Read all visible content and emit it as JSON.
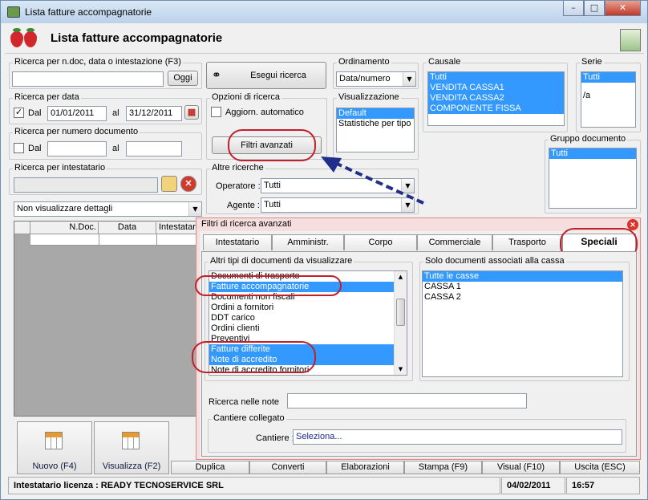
{
  "window": {
    "title": "Lista fatture accompagnatorie",
    "minimize": "–",
    "maximize": "□",
    "close": "✕"
  },
  "header": {
    "title": "Lista fatture accompagnatorie"
  },
  "search_ndoc": {
    "legend": "Ricerca per n.doc, data o intestazione (F3)",
    "value": "",
    "today_button": "Oggi"
  },
  "search_button": "Esegui ricerca",
  "ordering": {
    "legend": "Ordinamento",
    "value": "Data/numero"
  },
  "causale": {
    "legend": "Causale",
    "items": [
      "Tutti",
      "VENDITA CASSA1",
      "VENDITA CASSA2",
      "COMPONENTE FISSA"
    ]
  },
  "serie": {
    "legend": "Serie",
    "items": [
      "Tutti",
      "",
      "/a"
    ]
  },
  "search_date": {
    "legend": "Ricerca per data",
    "dal_label": "Dal",
    "dal_checked": "✓",
    "dal_value": "01/01/2011",
    "al_label": "al",
    "al_value": "31/12/2011"
  },
  "options": {
    "legend": "Opzioni di ricerca",
    "auto_update": "Aggiorn. automatico",
    "advanced_button": "Filtri avanzati"
  },
  "visualization": {
    "legend": "Visualizzazione",
    "items": [
      "Default",
      "Statistiche per tipo a"
    ]
  },
  "search_number": {
    "legend": "Ricerca per numero documento",
    "dal_label": "Dal",
    "al_label": "al"
  },
  "group_doc": {
    "legend": "Gruppo documento",
    "items": [
      "Tutti"
    ]
  },
  "search_holder": {
    "legend": "Ricerca per intestatario"
  },
  "other_search": {
    "legend": "Altre ricerche",
    "operator_label": "Operatore :",
    "operator_value": "Tutti",
    "agent_label": "Agente :",
    "agent_value": "Tutti"
  },
  "details_combo": "Non visualizzare dettagli",
  "grid": {
    "columns": [
      "N.Doc.",
      "Data",
      "Intestatario"
    ]
  },
  "advanced_panel": {
    "title": "Filtri di ricerca avanzati",
    "tabs": [
      "Intestatario",
      "Amministr.",
      "Corpo",
      "Commerciale",
      "Trasporto",
      "Speciali"
    ],
    "other_docs": {
      "legend": "Altri tipi di documenti da visualizzare",
      "items": [
        {
          "label": "Documenti di trasporto",
          "sel": false
        },
        {
          "label": "Fatture accompagnatorie",
          "sel": true
        },
        {
          "label": "Documenti non fiscali",
          "sel": false
        },
        {
          "label": "Ordini a fornitori",
          "sel": false
        },
        {
          "label": "DDT carico",
          "sel": false
        },
        {
          "label": "Ordini clienti",
          "sel": false
        },
        {
          "label": "Preventivi",
          "sel": false
        },
        {
          "label": "Fatture differite",
          "sel": true
        },
        {
          "label": "Note di accredito",
          "sel": true
        },
        {
          "label": "Note di accredito fornitori",
          "sel": false
        }
      ]
    },
    "cash_docs": {
      "legend": "Solo documenti associati alla cassa",
      "items": [
        "Tutte le casse",
        "CASSA 1",
        "CASSA 2"
      ]
    },
    "notes_label": "Ricerca nelle note",
    "site": {
      "legend": "Cantiere collegato",
      "label": "Cantiere :",
      "value": "Seleziona..."
    }
  },
  "toolbar": {
    "new": "Nuovo (F4)",
    "view": "Visualizza (F2)",
    "duplicate": "Duplica",
    "convert": "Converti",
    "processing": "Elaborazioni",
    "print": "Stampa (F9)",
    "preview": "Visual (F10)",
    "exit": "Uscita (ESC)"
  },
  "status": {
    "license": "Intestatario licenza : READY TECNOSERVICE SRL",
    "date": "04/02/2011",
    "time": "16:57"
  }
}
